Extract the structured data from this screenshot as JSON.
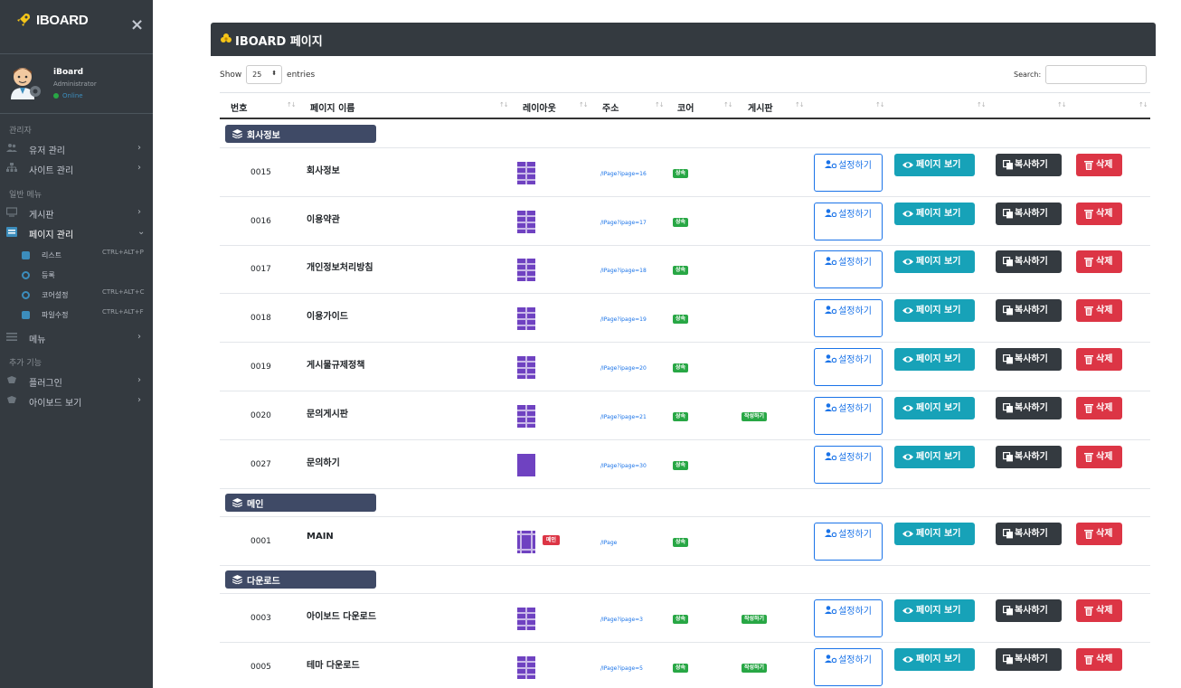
{
  "brand": {
    "name": "IBOARD",
    "close_symbol": "×"
  },
  "user": {
    "name": "iBoard",
    "role": "Administrator",
    "status": "Online"
  },
  "sidebar": {
    "sections": [
      {
        "header": "관리자"
      },
      {
        "header": "일반 메뉴"
      },
      {
        "header": "추가 기능"
      }
    ],
    "items": [
      {
        "label": "유저 관리",
        "icon": "users-icon",
        "arrow": "›"
      },
      {
        "label": "사이트 관리",
        "icon": "sitemap-icon",
        "arrow": "›"
      },
      {
        "label": "게시판",
        "icon": "board-icon",
        "arrow": "›"
      },
      {
        "label": "페이지 관리",
        "icon": "page-icon",
        "arrow": "⌄"
      },
      {
        "label": "메뉴",
        "icon": "menu-icon",
        "arrow": "›"
      },
      {
        "label": "플러그인",
        "icon": "plugin-icon",
        "arrow": "›"
      },
      {
        "label": "아이보드 보기",
        "icon": "plugin-icon",
        "arrow": "›"
      }
    ],
    "submenu": [
      {
        "label": "리스트",
        "shortcut": "CTRL+ALT+P",
        "icon": "list-icon"
      },
      {
        "label": "등록",
        "shortcut": "",
        "icon": "register-icon"
      },
      {
        "label": "코어설정",
        "shortcut": "CTRL+ALT+C",
        "icon": "core-settings-icon"
      },
      {
        "label": "파일수정",
        "shortcut": "CTRL+ALT+F",
        "icon": "file-edit-icon"
      }
    ]
  },
  "card": {
    "title": "IBOARD 페이지"
  },
  "table_controls": {
    "show_label": "Show",
    "entries_value": "25",
    "entries_label": "entries",
    "search_label": "Search:"
  },
  "table": {
    "headers": [
      "번호",
      "페이지 이름",
      "레이아웃",
      "주소",
      "코어",
      "게시판"
    ],
    "button_labels": {
      "settings": "설정하기",
      "view": "페이지 보기",
      "copy": "복사하기",
      "delete": "삭제"
    },
    "groups": [
      {
        "name": "회사정보"
      },
      {
        "name": "메인"
      },
      {
        "name": "다운로드"
      }
    ],
    "rows": [
      {
        "num": "0015",
        "name": "회사정보",
        "addr": "/IPage?ipage=16",
        "core": "상속",
        "board": "",
        "layout": "split",
        "main": ""
      },
      {
        "num": "0016",
        "name": "이용약관",
        "addr": "/IPage?ipage=17",
        "core": "상속",
        "board": "",
        "layout": "split",
        "main": ""
      },
      {
        "num": "0017",
        "name": "개인정보처리방침",
        "addr": "/IPage?ipage=18",
        "core": "상속",
        "board": "",
        "layout": "split",
        "main": ""
      },
      {
        "num": "0018",
        "name": "이용가이드",
        "addr": "/IPage?ipage=19",
        "core": "상속",
        "board": "",
        "layout": "split",
        "main": ""
      },
      {
        "num": "0019",
        "name": "게시물규제정책",
        "addr": "/IPage?ipage=20",
        "core": "상속",
        "board": "",
        "layout": "split",
        "main": ""
      },
      {
        "num": "0020",
        "name": "문의게시판",
        "addr": "/IPage?ipage=21",
        "core": "상속",
        "board": "작성하기",
        "layout": "split",
        "main": ""
      },
      {
        "num": "0027",
        "name": "문의하기",
        "addr": "/IPage?ipage=30",
        "core": "상속",
        "board": "",
        "layout": "full",
        "main": ""
      },
      {
        "num": "0001",
        "name": "MAIN",
        "addr": "/IPage",
        "core": "상속",
        "board": "",
        "layout": "sidebar",
        "main": "메인"
      },
      {
        "num": "0003",
        "name": "아이보드 다운로드",
        "addr": "/IPage?ipage=3",
        "core": "상속",
        "board": "작성하기",
        "layout": "split",
        "main": ""
      },
      {
        "num": "0005",
        "name": "테마 다운로드",
        "addr": "/IPage?ipage=5",
        "core": "상속",
        "board": "작성하기",
        "layout": "split",
        "main": ""
      }
    ]
  },
  "colors": {
    "sidebar_bg": "#343a40",
    "group_badge": "#3f4a66",
    "layout_purple": "#6f42c1",
    "view_button": "#17a2b8",
    "copy_button": "#343a40",
    "delete_button": "#dc3545",
    "settings_border": "#1a73e8",
    "core_badge": "#28a745"
  }
}
